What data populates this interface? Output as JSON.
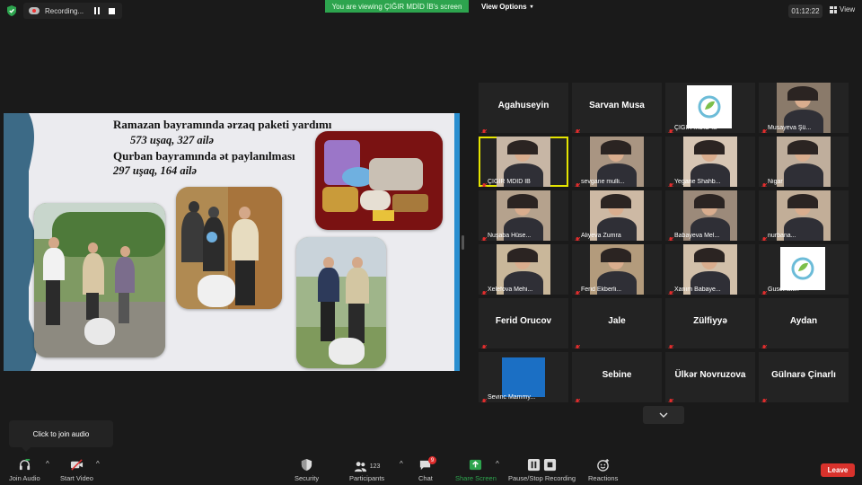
{
  "top": {
    "recording_label": "Recording...",
    "viewing_banner": "You are viewing ÇIĞIR MDİD İB's screen",
    "view_options_label": "View Options",
    "timer": "01:12:22",
    "view_label": "View"
  },
  "slide": {
    "line1": "Ramazan bayramında ərzaq paketi yardımı",
    "line2": "573 uşaq, 327 ailə",
    "line3": "Qurban bayramında ət paylanılması",
    "line4": "297 uşaq, 164 ailə"
  },
  "tiles": [
    {
      "name": "Agahuseyin",
      "caption": "",
      "type": "name"
    },
    {
      "name": "Sarvan Musa",
      "caption": "",
      "type": "name"
    },
    {
      "name": "",
      "caption": "ÇIĞIR MDİD İB",
      "type": "logo"
    },
    {
      "name": "",
      "caption": "Musayeva Şü...",
      "type": "video"
    },
    {
      "name": "",
      "caption": "ÇIĞIR MDİD İB",
      "type": "video",
      "active": true
    },
    {
      "name": "",
      "caption": "sevgane mulli...",
      "type": "video"
    },
    {
      "name": "",
      "caption": "Yegane Shahb...",
      "type": "video"
    },
    {
      "name": "",
      "caption": "Nigar",
      "type": "video"
    },
    {
      "name": "",
      "caption": "Nuşaba Hüse...",
      "type": "video"
    },
    {
      "name": "",
      "caption": "Aliyeva Zumra",
      "type": "video"
    },
    {
      "name": "",
      "caption": "Babayeva Mel...",
      "type": "video"
    },
    {
      "name": "",
      "caption": "nurbana...",
      "type": "video"
    },
    {
      "name": "",
      "caption": "Xelefova Mehi...",
      "type": "video"
    },
    {
      "name": "",
      "caption": "Ferid Ekberli...",
      "type": "video"
    },
    {
      "name": "",
      "caption": "Xanım Babaye...",
      "type": "video"
    },
    {
      "name": "",
      "caption": "Guseinskin",
      "type": "logo"
    },
    {
      "name": "Ferid Orucov",
      "caption": "",
      "type": "name"
    },
    {
      "name": "Jale",
      "caption": "",
      "type": "name"
    },
    {
      "name": "Zülfiyyə",
      "caption": "",
      "type": "name"
    },
    {
      "name": "Aydan",
      "caption": "",
      "type": "name"
    },
    {
      "name": "",
      "caption": "Sevinc Mammy...",
      "type": "screen"
    },
    {
      "name": "Sebine",
      "caption": "",
      "type": "name"
    },
    {
      "name": "Ülkər Novruzova",
      "caption": "",
      "type": "name"
    },
    {
      "name": "Gülnarə Çinarlı",
      "caption": "",
      "type": "name"
    }
  ],
  "tooltip": "Click to join audio",
  "toolbar": {
    "join_audio": "Join Audio",
    "start_video": "Start Video",
    "security": "Security",
    "participants": "Participants",
    "participants_count": "123",
    "chat": "Chat",
    "chat_badge": "9",
    "share_screen": "Share Screen",
    "record": "Pause/Stop Recording",
    "reactions": "Reactions",
    "leave": "Leave"
  },
  "colors": {
    "green": "#2da44e",
    "leave_red": "#d8322c",
    "active_outline": "#e4e400",
    "slide_stripe": "#2a8fd0"
  }
}
